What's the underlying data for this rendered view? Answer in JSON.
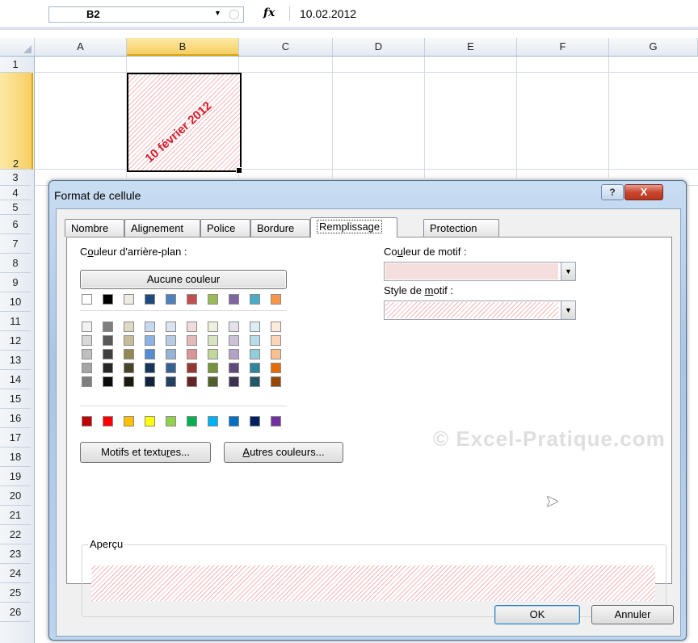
{
  "formula_bar": {
    "name_box": "B2",
    "fx": "fx",
    "formula": "10.02.2012"
  },
  "grid": {
    "columns": [
      "A",
      "B",
      "C",
      "D",
      "E",
      "F",
      "G"
    ],
    "selected_column": "B",
    "rows": [
      "1",
      "2",
      "3",
      "4",
      "5",
      "6",
      "7",
      "8",
      "9",
      "10",
      "11",
      "12",
      "13",
      "14",
      "15",
      "16",
      "17",
      "18",
      "19",
      "20",
      "21",
      "22",
      "23",
      "24",
      "25",
      "26"
    ],
    "selected_row": "2",
    "cell_b2_text": "10 février 2012",
    "cell_b2_color": "#d81c2a"
  },
  "dialog": {
    "title": "Format de cellule",
    "help_label": "?",
    "close_label": "X",
    "tabs": [
      "Nombre",
      "Alignement",
      "Police",
      "Bordure",
      "Remplissage",
      "Protection"
    ],
    "active_tab": "Remplissage",
    "background_color_label": {
      "pre": "C",
      "u": "o",
      "post": "uleur d'arrière-plan :"
    },
    "no_color_button": "Aucune couleur",
    "pattern_color_label": {
      "pre": "Co",
      "u": "u",
      "post": "leur de motif :"
    },
    "pattern_style_label": {
      "pre": "Style de ",
      "u": "m",
      "post": "otif :"
    },
    "pattern_fill_color": "#f5dede",
    "effects_button": {
      "pre": "Motifs et textu",
      "u": "r",
      "post": "es..."
    },
    "more_colors_button": {
      "pre": "",
      "u": "A",
      "post": "utres couleurs..."
    },
    "preview_label": "Aperçu",
    "ok_button": "OK",
    "cancel_button": "Annuler",
    "palette": {
      "theme_top": [
        "#ffffff",
        "#000000",
        "#eeece1",
        "#1f497d",
        "#4f81bd",
        "#c0504d",
        "#9bbb59",
        "#8064a2",
        "#4bacc6",
        "#f79646"
      ],
      "theme_shades": [
        [
          "#f2f2f2",
          "#7f7f7f",
          "#ddd9c3",
          "#c6d9f0",
          "#dbe5f1",
          "#f2dcdb",
          "#ebf1dd",
          "#e5e0ec",
          "#dbeef3",
          "#fdeada"
        ],
        [
          "#d8d8d8",
          "#595959",
          "#c4bd97",
          "#8db3e2",
          "#b8cce4",
          "#e5b9b7",
          "#d7e3bc",
          "#ccc1d9",
          "#b7dde8",
          "#fbd5b5"
        ],
        [
          "#bfbfbf",
          "#3f3f3f",
          "#938953",
          "#548dd4",
          "#95b3d7",
          "#d99694",
          "#c3d69b",
          "#b2a2c7",
          "#92cddc",
          "#fac08f"
        ],
        [
          "#a5a5a5",
          "#262626",
          "#494429",
          "#17365d",
          "#366092",
          "#953734",
          "#76923c",
          "#5f497a",
          "#31859b",
          "#e36c09"
        ],
        [
          "#7f7f7f",
          "#0c0c0c",
          "#1d1b10",
          "#0f243e",
          "#244061",
          "#632423",
          "#4f6128",
          "#3f3151",
          "#205867",
          "#974806"
        ]
      ],
      "standard": [
        "#c00000",
        "#ff0000",
        "#ffc000",
        "#ffff00",
        "#92d050",
        "#00b050",
        "#00b0f0",
        "#0070c0",
        "#002060",
        "#7030a0"
      ]
    }
  },
  "watermark": "© Excel-Pratique.com"
}
